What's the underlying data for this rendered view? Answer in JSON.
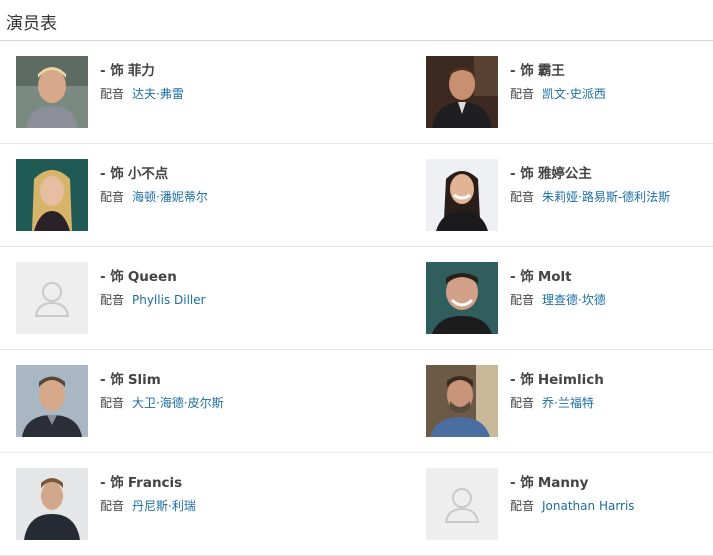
{
  "header": {
    "title": "演员表"
  },
  "cast": [
    {
      "role_prefix": "- 饰",
      "role": "菲力",
      "voice_label": "配音",
      "voice_actor": "达夫·弗雷",
      "photo": "actor-photo"
    },
    {
      "role_prefix": "- 饰",
      "role": "霸王",
      "voice_label": "配音",
      "voice_actor": "凯文·史派西",
      "photo": "actor-photo"
    },
    {
      "role_prefix": "- 饰",
      "role": "小不点",
      "voice_label": "配音",
      "voice_actor": "海顿·潘妮蒂尔",
      "photo": "actor-photo"
    },
    {
      "role_prefix": "- 饰",
      "role": "雅婷公主",
      "voice_label": "配音",
      "voice_actor": "朱莉娅·路易斯-德利法斯",
      "photo": "actor-photo"
    },
    {
      "role_prefix": "- 饰",
      "role": "Queen",
      "voice_label": "配音",
      "voice_actor": "Phyllis Diller",
      "photo": "placeholder-avatar-icon"
    },
    {
      "role_prefix": "- 饰",
      "role": "Molt",
      "voice_label": "配音",
      "voice_actor": "理查德·坎德",
      "photo": "actor-photo"
    },
    {
      "role_prefix": "- 饰",
      "role": "Slim",
      "voice_label": "配音",
      "voice_actor": "大卫·海德·皮尔斯",
      "photo": "actor-photo"
    },
    {
      "role_prefix": "- 饰",
      "role": "Heimlich",
      "voice_label": "配音",
      "voice_actor": "乔·兰福特",
      "photo": "actor-photo"
    },
    {
      "role_prefix": "- 饰",
      "role": "Francis",
      "voice_label": "配音",
      "voice_actor": "丹尼斯·利瑞",
      "photo": "actor-photo"
    },
    {
      "role_prefix": "- 饰",
      "role": "Manny",
      "voice_label": "配音",
      "voice_actor": "Jonathan Harris",
      "photo": "placeholder-avatar-icon"
    }
  ],
  "colors": {
    "link": "#1c6ea3",
    "text": "#444444",
    "divider": "#e6e6e6"
  }
}
